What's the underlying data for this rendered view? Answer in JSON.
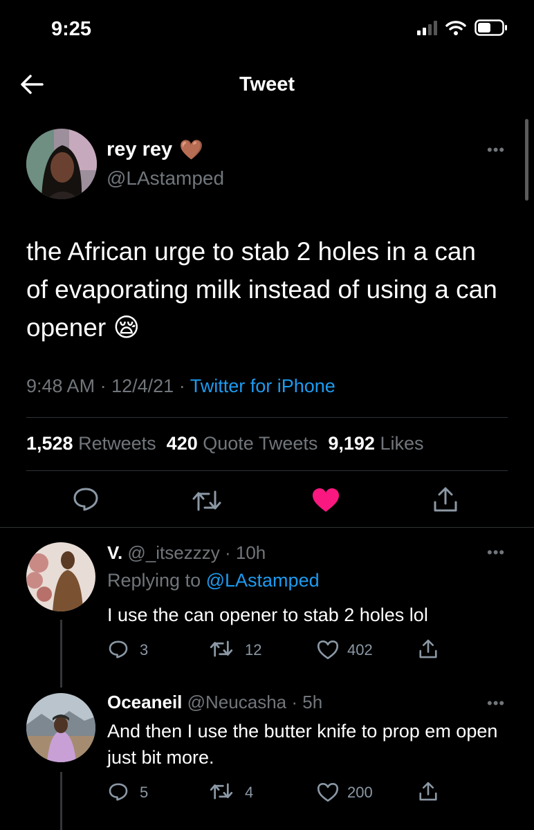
{
  "status": {
    "time": "9:25"
  },
  "header": {
    "title": "Tweet"
  },
  "tweet": {
    "display_name": "rey rey",
    "name_emoji": "🤎",
    "handle": "@LAstamped",
    "text": "the African urge to stab 2 holes in a can of evaporating milk instead of using a can opener",
    "text_emoji": "😪",
    "time": "9:48 AM",
    "date": "12/4/21",
    "source": "Twitter for iPhone",
    "separator": "·",
    "retweets_count": "1,528",
    "retweets_label": "Retweets",
    "quotes_count": "420",
    "quotes_label": "Quote Tweets",
    "likes_count": "9,192",
    "likes_label": "Likes",
    "liked": true
  },
  "replies": [
    {
      "display_name": "V.",
      "handle": "@_itsezzzy",
      "age": "10h",
      "replying_label": "Replying to",
      "replying_to": "@LAstamped",
      "text": "I use the can opener to stab 2 holes lol",
      "reply_count": "3",
      "retweet_count": "12",
      "like_count": "402"
    },
    {
      "display_name": "Oceaneil",
      "handle": "@Neucasha",
      "age": "5h",
      "text": "And then I use the butter knife to prop em open just bit more.",
      "reply_count": "5",
      "retweet_count": "4",
      "like_count": "200"
    }
  ],
  "colors": {
    "background": "#000000",
    "text_primary": "#ffffff",
    "text_secondary": "#71767b",
    "link": "#1d9bf0",
    "like": "#f91880",
    "divider": "#2f3336"
  },
  "icons": [
    "signal-icon",
    "wifi-icon",
    "battery-icon",
    "back-arrow-icon",
    "more-icon",
    "reply-icon",
    "retweet-icon",
    "like-icon",
    "share-icon"
  ]
}
